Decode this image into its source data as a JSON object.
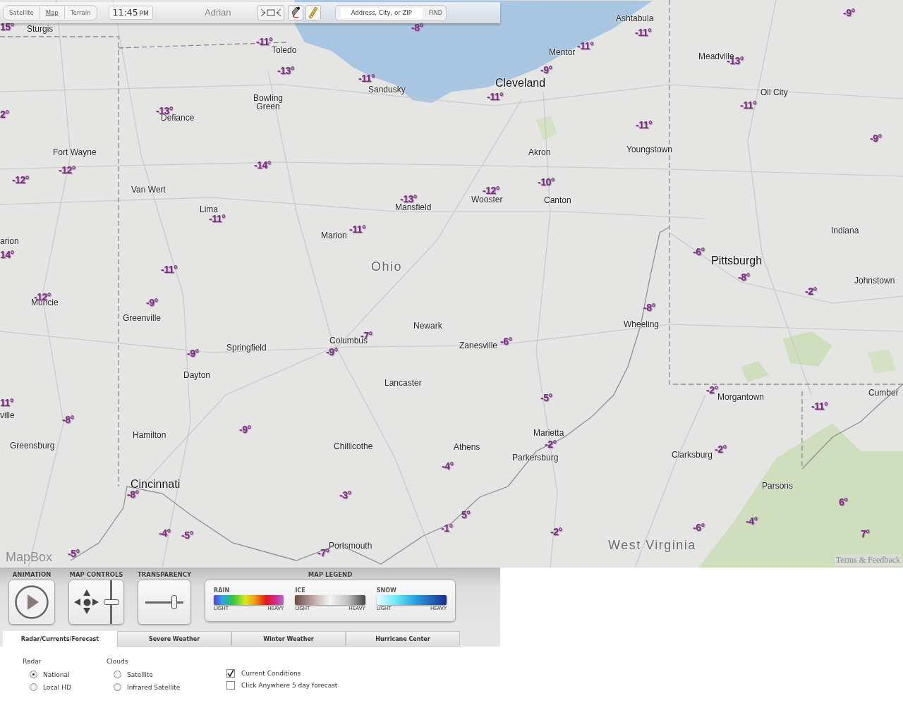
{
  "toolbar": {
    "map_types": [
      {
        "label": "Satellite",
        "selected": false
      },
      {
        "label": "Map",
        "selected": true
      },
      {
        "label": "Terrain",
        "selected": false
      }
    ],
    "time": "11:45",
    "period": "PM",
    "search": {
      "placeholder": "Address, City, or ZIP",
      "button": "FIND"
    }
  },
  "map": {
    "places": [
      {
        "name": "Adrian",
        "kind": "faded"
      },
      {
        "name": "Sturgis",
        "kind": "city"
      },
      {
        "name": "Toledo",
        "kind": "city"
      },
      {
        "name": "Sandusky",
        "kind": "city"
      },
      {
        "name": "Bowling Green",
        "kind": "city"
      },
      {
        "name": "Defiance",
        "kind": "city"
      },
      {
        "name": "Fort Wayne",
        "kind": "city"
      },
      {
        "name": "Van Wert",
        "kind": "city"
      },
      {
        "name": "Lima",
        "kind": "city"
      },
      {
        "name": "Mansfield",
        "kind": "city"
      },
      {
        "name": "Marion",
        "kind": "city"
      },
      {
        "name": "arion",
        "kind": "city"
      },
      {
        "name": "Ohio",
        "kind": "state"
      },
      {
        "name": "Cleveland",
        "kind": "major"
      },
      {
        "name": "Mentor",
        "kind": "city"
      },
      {
        "name": "Ashtabula",
        "kind": "city"
      },
      {
        "name": "Meadville",
        "kind": "city"
      },
      {
        "name": "Oil City",
        "kind": "city"
      },
      {
        "name": "Akron",
        "kind": "city"
      },
      {
        "name": "Youngstown",
        "kind": "city"
      },
      {
        "name": "Wooster",
        "kind": "city"
      },
      {
        "name": "Canton",
        "kind": "city"
      },
      {
        "name": "Indiana",
        "kind": "city"
      },
      {
        "name": "Pittsburgh",
        "kind": "major"
      },
      {
        "name": "Johnstown",
        "kind": "city"
      },
      {
        "name": "Muncie",
        "kind": "city"
      },
      {
        "name": "Greenville",
        "kind": "city"
      },
      {
        "name": "Springfield",
        "kind": "city"
      },
      {
        "name": "Columbus",
        "kind": "city"
      },
      {
        "name": "Newark",
        "kind": "city"
      },
      {
        "name": "Zanesville",
        "kind": "city"
      },
      {
        "name": "Wheeling",
        "kind": "city"
      },
      {
        "name": "Dayton",
        "kind": "city"
      },
      {
        "name": "Lancaster",
        "kind": "city"
      },
      {
        "name": "ville",
        "kind": "city"
      },
      {
        "name": "Morgantown",
        "kind": "city"
      },
      {
        "name": "Cumber",
        "kind": "city"
      },
      {
        "name": "Greensburg",
        "kind": "city"
      },
      {
        "name": "Hamilton",
        "kind": "city"
      },
      {
        "name": "Chillicothe",
        "kind": "city"
      },
      {
        "name": "Athens",
        "kind": "city"
      },
      {
        "name": "Marietta",
        "kind": "city"
      },
      {
        "name": "Parkersburg",
        "kind": "city"
      },
      {
        "name": "Clarksburg",
        "kind": "city"
      },
      {
        "name": "Cincinnati",
        "kind": "major"
      },
      {
        "name": "Parsons",
        "kind": "city"
      },
      {
        "name": "Portsmouth",
        "kind": "city"
      },
      {
        "name": "West Virginia",
        "kind": "state"
      }
    ],
    "temperatures": [
      "15°",
      "-8°",
      "-11°",
      "-13°",
      "-11°",
      "-13°",
      "2°",
      "-12°",
      "-12°",
      "-14°",
      "-11°",
      "-13°",
      "-11°",
      "14°",
      "-11°",
      "-12°",
      "-9°",
      "-9°",
      "-7°",
      "-9°",
      "-9°",
      "11°",
      "-8°",
      "-8°",
      "-4°",
      "-5°",
      "-5°",
      "-3°",
      "-7°",
      "-4°",
      "-1°",
      "5°",
      "-2°",
      "-5°",
      "-2°",
      "-6°",
      "-8°",
      "-2°",
      "-11°",
      "-2°",
      "-6°",
      "-4°",
      "6°",
      "7°",
      "-11°",
      "-9°",
      "-11°",
      "-11°",
      "-9°",
      "-13°",
      "-11°",
      "-11°",
      "-9°",
      "-12°",
      "-10°",
      "-6°",
      "-8°",
      "-2°"
    ],
    "attribution": "MapBox",
    "terms": "Terms & Feedback"
  },
  "panel": {
    "animation": {
      "heading": "ANIMATION"
    },
    "map_controls": {
      "heading": "MAP CONTROLS",
      "zoom": {
        "level": 0.5
      }
    },
    "transparency": {
      "heading": "TRANSPARENCY",
      "level": 0.75
    },
    "legend": {
      "heading": "MAP LEGEND",
      "scales": [
        {
          "label": "RAIN",
          "kind": "rain",
          "low": "LIGHT",
          "high": "HEAVY"
        },
        {
          "label": "ICE",
          "kind": "ice",
          "low": "LIGHT",
          "high": "HEAVY"
        },
        {
          "label": "SNOW",
          "kind": "snow",
          "low": "LIGHT",
          "high": "HEAVY"
        }
      ]
    },
    "tabs": [
      {
        "label": "Radar/Currents/Forecast",
        "selected": true
      },
      {
        "label": "Severe Weather",
        "selected": false
      },
      {
        "label": "Winter Weather",
        "selected": false
      },
      {
        "label": "Hurricane Center",
        "selected": false
      }
    ],
    "radar": {
      "title": "Radar",
      "options": [
        {
          "label": "National",
          "selected": true
        },
        {
          "label": "Local HD",
          "selected": false
        }
      ]
    },
    "clouds": {
      "title": "Clouds",
      "options": [
        {
          "label": "Satellite",
          "selected": false
        },
        {
          "label": "Infrared Satellite",
          "selected": false
        }
      ]
    },
    "layers": [
      {
        "label": "Current Conditions",
        "checked": true
      },
      {
        "label": "Click Anywhere 5 day forecast",
        "checked": false
      }
    ]
  }
}
